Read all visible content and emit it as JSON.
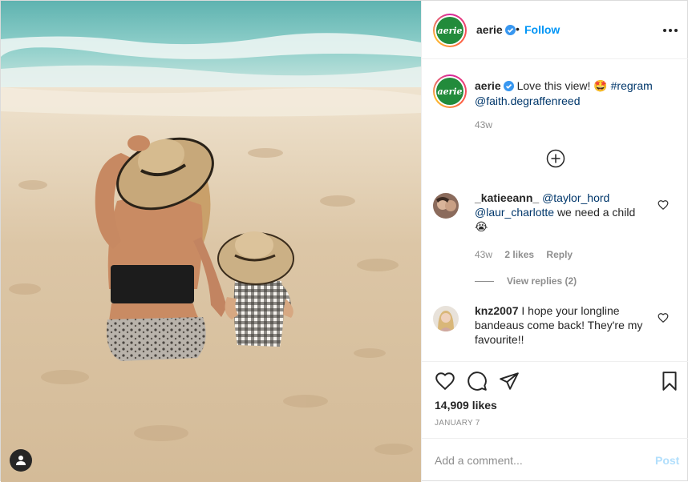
{
  "header": {
    "username": "aerie",
    "avatar_text": "aerie",
    "separator": "•",
    "follow_label": "Follow"
  },
  "caption": {
    "username": "aerie",
    "text": "Love this view!",
    "emoji": "🤩",
    "hashtag": "#regram",
    "mention": "@faith.degraffenreed",
    "time": "43w"
  },
  "comments": [
    {
      "username": "_katieeann_",
      "mention1": "@taylor_hord",
      "mention2": "@laur_charlotte",
      "text": "we need a child",
      "emoji": "😭",
      "time": "43w",
      "likes": "2 likes",
      "reply_label": "Reply",
      "view_replies": "View replies (2)"
    },
    {
      "username": "knz2007",
      "text": "I hope your longline bandeaus come back! They're my favourite!!"
    }
  ],
  "actions": {
    "likes": "14,909 likes",
    "date": "JANUARY 7"
  },
  "add_comment": {
    "placeholder": "Add a comment...",
    "post_label": "Post"
  },
  "colors": {
    "link": "#00376b",
    "follow": "#0095f6",
    "verified": "#3897f0",
    "brand_green": "#228b3b"
  }
}
